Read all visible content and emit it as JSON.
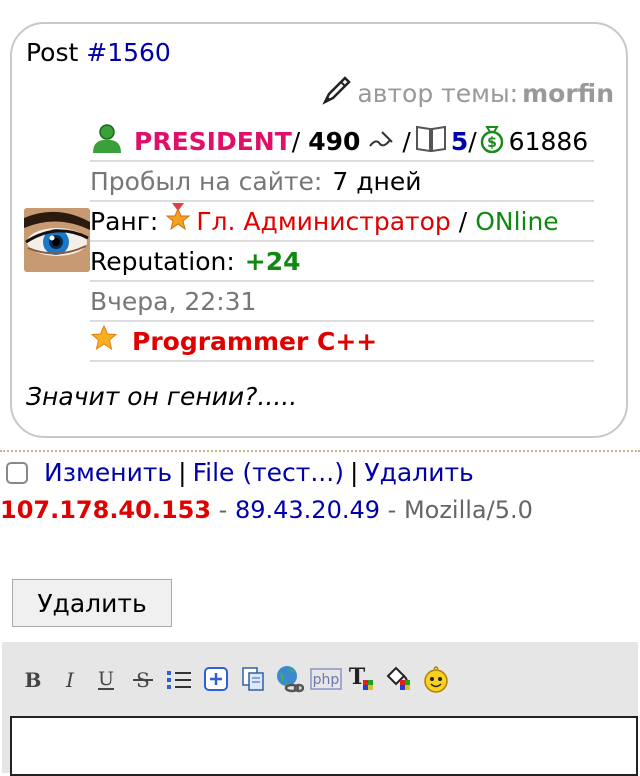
{
  "post": {
    "label": "Post ",
    "number": "#1560",
    "topic_author_label": "автор темы:",
    "topic_author_name": "morfin",
    "status": "PRESIDENT",
    "sep1": "/",
    "posts_count": "490",
    "sep2": "/",
    "books_count": "5",
    "sep3": "/",
    "money": "61886",
    "time_on_site_label": "Пробыл на сайте:",
    "time_on_site_value": "7 дней",
    "rank_label": "Ранг:",
    "rank_value": "Гл. Администратор",
    "sep4": "/",
    "online": "ONline",
    "reputation_label": "Reputation:",
    "reputation_value": "+24",
    "last_seen": "Вчера, 22:31",
    "title_badge": "Programmer C++",
    "message": "Значит он гении?....."
  },
  "actions": {
    "edit": "Изменить",
    "sep": "|",
    "file": "File (тест...)",
    "delete": "Удалить"
  },
  "ip": {
    "ip1": "107.178.40.153",
    "sep": " - ",
    "ip2": "89.43.20.49",
    "ua": "Mozilla/5.0"
  },
  "form": {
    "delete_button": "Удалить"
  },
  "toolbar": {
    "tools": [
      "bold-icon",
      "italic-icon",
      "underline-icon",
      "strikethrough-icon",
      "list-icon",
      "spoiler-icon",
      "copy-icon",
      "link-icon",
      "php-icon",
      "text-color-icon",
      "fill-color-icon",
      "smiley-icon"
    ]
  },
  "colors": {
    "status": "#e0106a",
    "link": "#0000aa",
    "rank": "#e00000",
    "online": "#118811",
    "border": "#c8c8c8",
    "toolbar_bg": "#e6e6e6"
  }
}
